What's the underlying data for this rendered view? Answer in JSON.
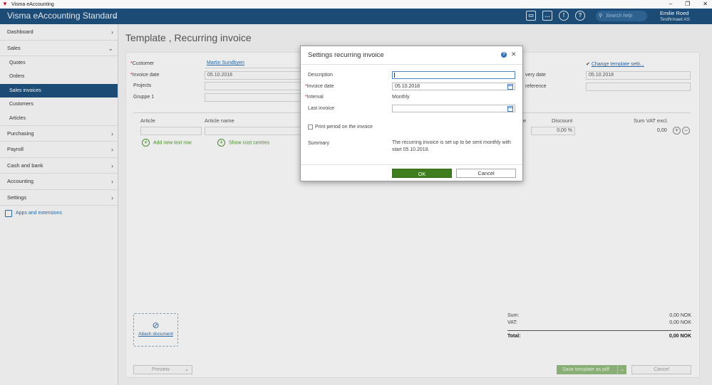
{
  "window": {
    "title": "Visma eAccounting",
    "controls": [
      "–",
      "❐",
      "✕"
    ]
  },
  "header": {
    "brand": "Visma eAccounting Standard",
    "icons": [
      "printer-icon",
      "chat-icon",
      "alert-icon",
      "help-icon"
    ],
    "search_placeholder": "Search help",
    "user_name": "Emilie Roed",
    "company": "Testfirmaet AS"
  },
  "sidebar": {
    "dashboard": "Dashboard",
    "sales": "Sales",
    "sales_items": [
      "Quotes",
      "Orders",
      "Sales invoices",
      "Customers",
      "Articles"
    ],
    "active_sales_item": "Sales invoices",
    "purchasing": "Purchasing",
    "payroll": "Payroll",
    "cash_and_bank": "Cash and bank",
    "accounting": "Accounting",
    "settings": "Settings",
    "apps": "Apps and extensions"
  },
  "page": {
    "title": "Template , Recurring invoice",
    "form": {
      "customer_label": "Customer",
      "customer_value": "Martin Sundbyen",
      "invoice_date_label": "Invoice date",
      "invoice_date_value": "05.10.2018",
      "projects_label": "Projects",
      "gruppe_label": "Gruppe 1",
      "delivery_date_label": "very date",
      "delivery_date_value": "05.10.2018",
      "reference_label": "reference",
      "change_template": "Change template setti..."
    },
    "table": {
      "col_article": "Article",
      "col_article_name": "Article name",
      "col_e": "e",
      "col_discount": "Discount",
      "col_sum": "Sum VAT excl.",
      "discount_value": "0,00 %",
      "sum_value": "0,00",
      "add_text_row": "Add new text row",
      "show_cost_centres": "Show cost centres"
    },
    "attach": "Attach document",
    "totals": {
      "sum_label": "Sum:",
      "sum_value": "0,00 NOK",
      "vat_label": "VAT:",
      "vat_value": "0,00 NOK",
      "total_label": "Total:",
      "total_value": "0,00 NOK"
    },
    "footer": {
      "preview": "Preview",
      "save_pdf": "Save template as pdf",
      "cancel": "Cancel"
    }
  },
  "modal": {
    "title": "Settings recurring invoice",
    "description_label": "Description",
    "description_value": "",
    "invoice_date_label": "Invoice date",
    "invoice_date_value": "05.10.2018",
    "interval_label": "Interval",
    "interval_value": "Monthly",
    "last_invoice_label": "Last invoice",
    "last_invoice_value": "",
    "print_period_label": "Print period on the invoice",
    "summary_label": "Summary",
    "summary_text": "The recurring invoice is set up to be sent monthly with start 05.10.2018.",
    "ok": "OK",
    "cancel": "Cancel"
  }
}
